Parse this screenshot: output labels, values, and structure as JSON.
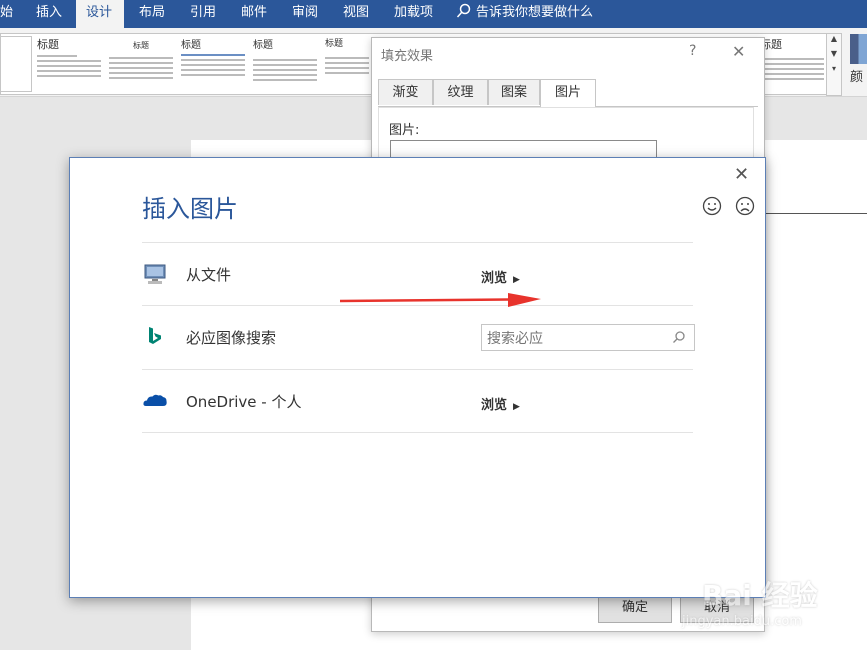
{
  "ribbon": {
    "tabs": [
      {
        "label": "始",
        "active": false
      },
      {
        "label": "插入",
        "active": false
      },
      {
        "label": "设计",
        "active": true
      },
      {
        "label": "布局",
        "active": false
      },
      {
        "label": "引用",
        "active": false
      },
      {
        "label": "邮件",
        "active": false
      },
      {
        "label": "审阅",
        "active": false
      },
      {
        "label": "视图",
        "active": false
      },
      {
        "label": "加载项",
        "active": false
      }
    ],
    "tell_me": "告诉我你想要做什么",
    "gallery_titles": [
      "标题",
      "标题",
      "标题",
      "标题",
      "标题",
      "标题"
    ],
    "colors_label": "颜",
    "accent": "#2b579a"
  },
  "fill_dialog": {
    "title": "填充效果",
    "help": "?",
    "close": "✕",
    "tabs": [
      "渐变",
      "纹理",
      "图案",
      "图片"
    ],
    "active_tab": "图片",
    "picture_label": "图片:",
    "ok": "确定",
    "cancel": "取消"
  },
  "insert_dialog": {
    "title": "插入图片",
    "close": "✕",
    "feedback_happy": "happy-face-icon",
    "feedback_sad": "sad-face-icon",
    "rows": [
      {
        "icon": "computer-icon",
        "label": "从文件",
        "action": "浏览"
      },
      {
        "icon": "bing-icon",
        "label": "必应图像搜索",
        "placeholder": "搜索必应"
      },
      {
        "icon": "onedrive-icon",
        "label": "OneDrive - 个人",
        "action": "浏览"
      }
    ]
  },
  "watermark": {
    "brand": "Bai 经验",
    "url": "jingyan.baidu.com"
  }
}
